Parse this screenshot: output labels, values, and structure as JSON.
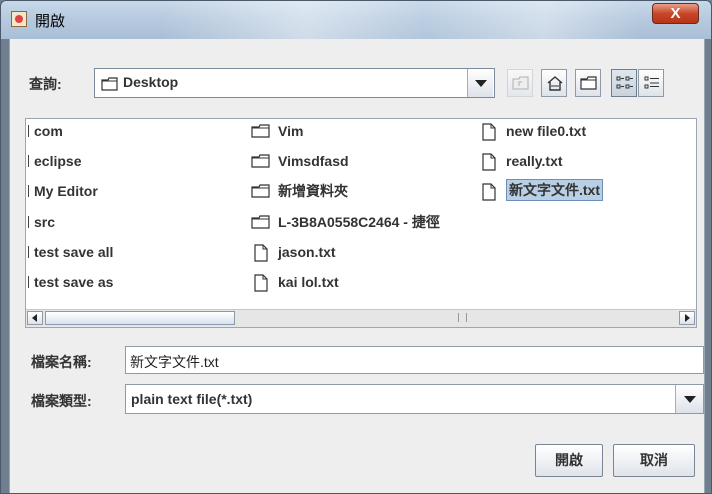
{
  "window": {
    "title": "開啟",
    "close_label": "X"
  },
  "lookin": {
    "label": "查詢:",
    "value": "Desktop"
  },
  "toolbar": {
    "buttons": [
      {
        "name": "up-one-level",
        "icon": "folder-up-icon",
        "disabled": true
      },
      {
        "name": "home",
        "icon": "home-icon",
        "disabled": false
      },
      {
        "name": "new-folder",
        "icon": "new-folder-icon",
        "disabled": false
      },
      {
        "name": "list-view",
        "icon": "list-view-icon",
        "disabled": false,
        "pressed": true
      },
      {
        "name": "details-view",
        "icon": "details-view-icon",
        "disabled": false
      }
    ]
  },
  "files": {
    "column1": [
      "com",
      "eclipse",
      "My Editor",
      "src",
      "test save all",
      "test save as"
    ],
    "column2": [
      {
        "name": "Vim",
        "type": "folder"
      },
      {
        "name": "Vimsdfasd",
        "type": "folder"
      },
      {
        "name": "新增資料夾",
        "type": "folder"
      },
      {
        "name": "L-3B8A0558C2464 - 捷徑",
        "type": "folder"
      },
      {
        "name": "jason.txt",
        "type": "file"
      },
      {
        "name": "kai lol.txt",
        "type": "file"
      }
    ],
    "column3": [
      {
        "name": "new file0.txt",
        "type": "file"
      },
      {
        "name": "really.txt",
        "type": "file"
      },
      {
        "name": "新文字文件.txt",
        "type": "file",
        "selected": true
      }
    ]
  },
  "filename": {
    "label": "檔案名稱:",
    "value": "新文字文件.txt"
  },
  "filetype": {
    "label": "檔案類型:",
    "value": "plain text file(*.txt)"
  },
  "buttons": {
    "open": "開啟",
    "cancel": "取消"
  },
  "colors": {
    "selection": "#b8cfe5",
    "selection_border": "#6d8fb8",
    "close": "#c9462a"
  }
}
